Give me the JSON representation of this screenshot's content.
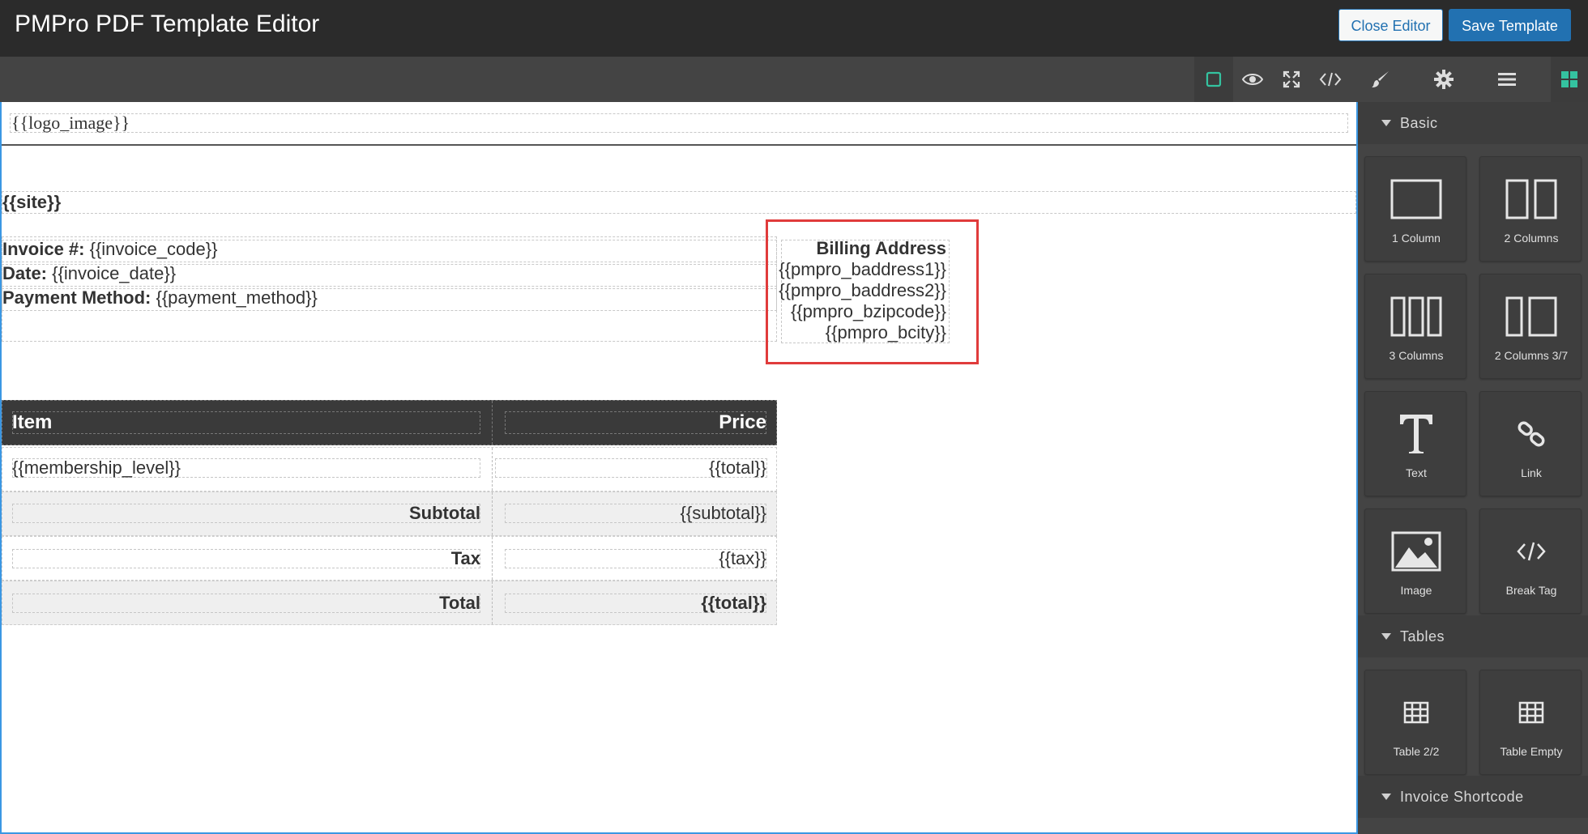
{
  "header": {
    "title": "PMPro PDF Template Editor",
    "close_label": "Close Editor",
    "save_label": "Save Template"
  },
  "toolbar": {
    "icons": [
      "outline-square-icon",
      "eye-icon",
      "fullscreen-icon",
      "code-icon",
      "brush-icon",
      "gear-icon",
      "menu-icon",
      "blocks-grid-icon"
    ],
    "accent_color": "#34c3a0"
  },
  "canvas": {
    "logo": "{{logo_image}}",
    "site": "{{site}}",
    "invoice_label": "Invoice #:",
    "invoice_value": " {{invoice_code}}",
    "date_label": "Date:",
    "date_value": " {{invoice_date}}",
    "payment_label": "Payment Method:",
    "payment_value": " {{payment_method}}",
    "billing": {
      "title": "Billing Address",
      "lines": [
        "{{pmpro_baddress1}}",
        "{{pmpro_baddress2}}",
        "{{pmpro_bzipcode}}",
        "{{pmpro_bcity}}"
      ],
      "highlight_color": "#e03b3b"
    },
    "table": {
      "headers": [
        "Item",
        "Price"
      ],
      "rows": [
        {
          "left": "{{membership_level}}",
          "right": "{{total}}"
        },
        {
          "left": "Subtotal",
          "right": "{{subtotal}}"
        },
        {
          "left": "Tax",
          "right": "{{tax}}"
        },
        {
          "left": "Total",
          "right": "{{total}}"
        }
      ]
    }
  },
  "panel": {
    "categories": [
      "Basic",
      "Tables",
      "Invoice Shortcode"
    ],
    "blocks": {
      "basic": [
        "1 Column",
        "2 Columns",
        "3 Columns",
        "2 Columns 3/7",
        "Text",
        "Link",
        "Image",
        "Break Tag"
      ],
      "tables": [
        "Table 2/2",
        "Table Empty"
      ]
    }
  }
}
